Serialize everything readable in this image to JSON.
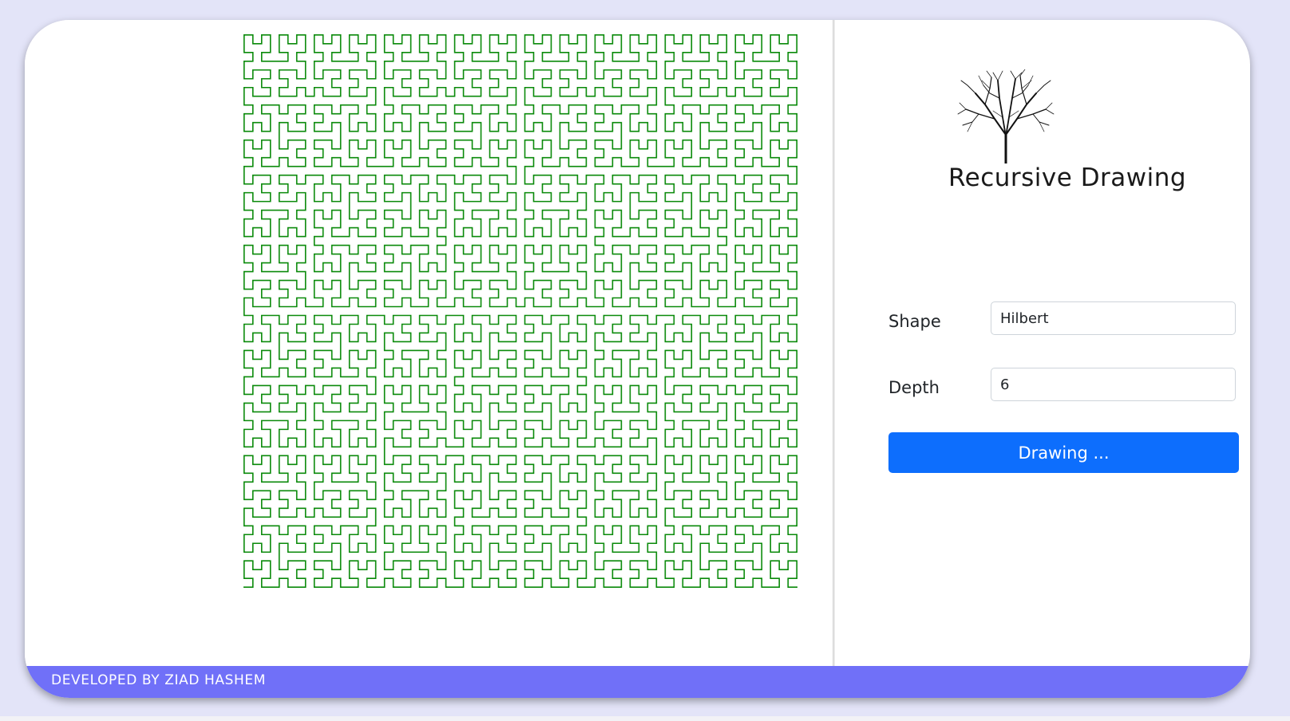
{
  "app": {
    "title": "Recursive Drawing",
    "logo_icon": "tree-icon"
  },
  "form": {
    "shape_label": "Shape",
    "shape_value": "Hilbert",
    "depth_label": "Depth",
    "depth_value": "6",
    "draw_button_label": "Drawing ..."
  },
  "footer": {
    "text": "Developed by Ziad Hashem"
  },
  "drawing": {
    "shape": "Hilbert",
    "depth": 6,
    "stroke_color": "#0a8a0a"
  },
  "colors": {
    "page_background": "#e3e4f8",
    "accent": "#0d6efd",
    "footer": "#7070f8"
  }
}
